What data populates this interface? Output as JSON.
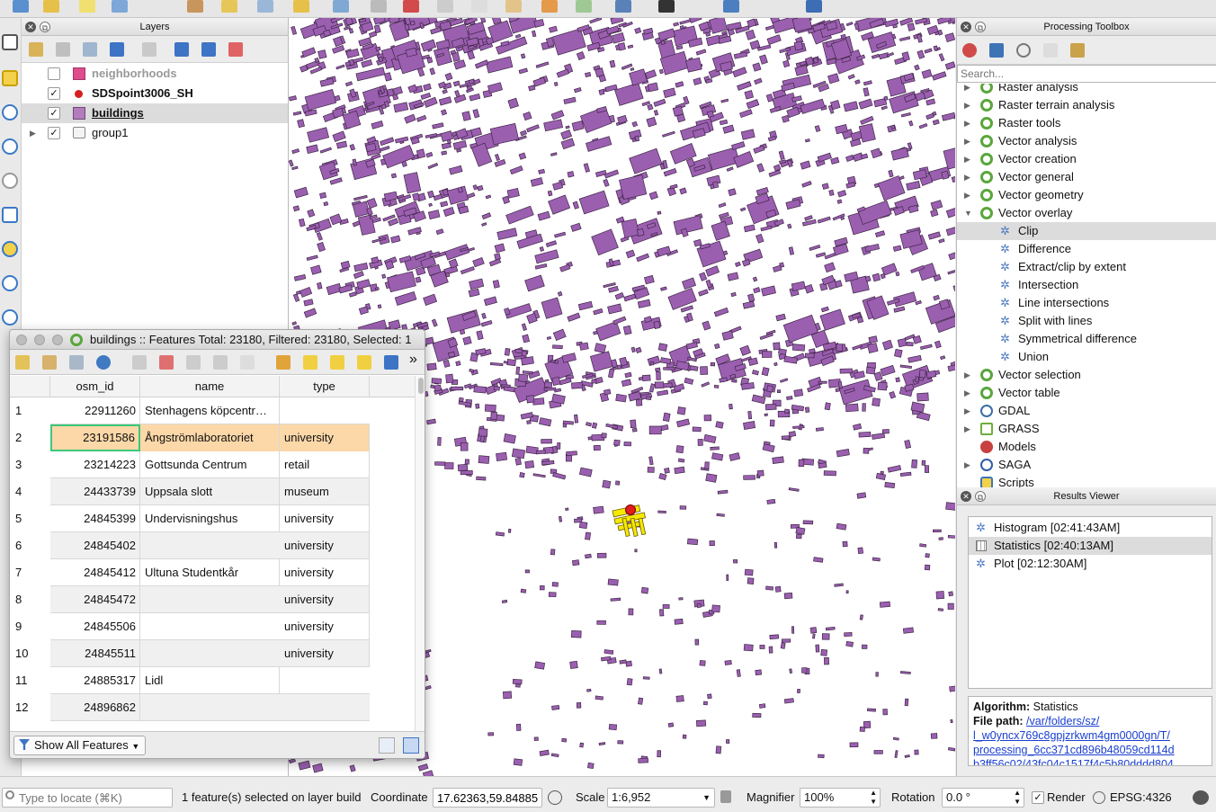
{
  "layers_panel": {
    "title": "Layers",
    "layers": [
      {
        "name": "neighborhoods",
        "checked": false,
        "symbol": "square",
        "color": "#e04b8b"
      },
      {
        "name": "SDSpoint3006_SH",
        "checked": true,
        "symbol": "dot",
        "color": "#d42020"
      },
      {
        "name": "buildings",
        "checked": true,
        "symbol": "square",
        "color": "#b27cbd"
      },
      {
        "name": "group1",
        "checked": true,
        "symbol": "group",
        "color": "#888888"
      }
    ]
  },
  "toolbox": {
    "title": "Processing Toolbox",
    "search_placeholder": "Search...",
    "items": [
      {
        "label": "Raster analysis",
        "type": "q-group"
      },
      {
        "label": "Raster terrain analysis",
        "type": "q-group"
      },
      {
        "label": "Raster tools",
        "type": "q-group"
      },
      {
        "label": "Vector analysis",
        "type": "q-group"
      },
      {
        "label": "Vector creation",
        "type": "q-group"
      },
      {
        "label": "Vector general",
        "type": "q-group"
      },
      {
        "label": "Vector geometry",
        "type": "q-group"
      },
      {
        "label": "Vector overlay",
        "type": "q-group-open"
      },
      {
        "label": "Clip",
        "type": "alg"
      },
      {
        "label": "Difference",
        "type": "alg"
      },
      {
        "label": "Extract/clip by extent",
        "type": "alg"
      },
      {
        "label": "Intersection",
        "type": "alg"
      },
      {
        "label": "Line intersections",
        "type": "alg"
      },
      {
        "label": "Split with lines",
        "type": "alg"
      },
      {
        "label": "Symmetrical difference",
        "type": "alg"
      },
      {
        "label": "Union",
        "type": "alg"
      },
      {
        "label": "Vector selection",
        "type": "q-group"
      },
      {
        "label": "Vector table",
        "type": "q-group"
      },
      {
        "label": "GDAL",
        "type": "gdal"
      },
      {
        "label": "GRASS",
        "type": "grass"
      },
      {
        "label": "Models",
        "type": "models"
      },
      {
        "label": "SAGA",
        "type": "saga"
      },
      {
        "label": "Scripts",
        "type": "scripts"
      }
    ],
    "selected": "Clip"
  },
  "results_viewer": {
    "title": "Results Viewer",
    "items": [
      {
        "label": "Histogram [02:41:43AM]"
      },
      {
        "label": "Statistics [02:40:13AM]"
      },
      {
        "label": "Plot [02:12:30AM]"
      }
    ],
    "selected": "Statistics [02:40:13AM]",
    "algorithm_label": "Algorithm:",
    "algorithm_value": "Statistics",
    "filepath_label": "File path:",
    "filepath_lines": [
      "/var/folders/sz/",
      "l_w0yncx769c8gpjzrkwm4gm0000gn/T/",
      "processing_6cc371cd896b48059cd114d",
      "b3ff56c02/43fc04c1517f4c5b80dddd804"
    ]
  },
  "attribute_table": {
    "title": "buildings :: Features Total: 23180, Filtered: 23180, Selected: 1",
    "columns": [
      "osm_id",
      "name",
      "type"
    ],
    "rows": [
      {
        "n": "1",
        "osm_id": "22911260",
        "name": "Stenhagens köpcentr…",
        "type": ""
      },
      {
        "n": "2",
        "osm_id": "23191586",
        "name": "Ångströmlaboratoriet",
        "type": "university"
      },
      {
        "n": "3",
        "osm_id": "23214223",
        "name": "Gottsunda Centrum",
        "type": "retail"
      },
      {
        "n": "4",
        "osm_id": "24433739",
        "name": "Uppsala slott",
        "type": "museum"
      },
      {
        "n": "5",
        "osm_id": "24845399",
        "name": "Undervisningshus",
        "type": "university"
      },
      {
        "n": "6",
        "osm_id": "24845402",
        "name": "",
        "type": "university"
      },
      {
        "n": "7",
        "osm_id": "24845412",
        "name": "Ultuna Studentkår",
        "type": "university"
      },
      {
        "n": "8",
        "osm_id": "24845472",
        "name": "",
        "type": "university"
      },
      {
        "n": "9",
        "osm_id": "24845506",
        "name": "",
        "type": "university"
      },
      {
        "n": "10",
        "osm_id": "24845511",
        "name": "",
        "type": "university"
      },
      {
        "n": "11",
        "osm_id": "24885317",
        "name": "Lidl",
        "type": ""
      },
      {
        "n": "12",
        "osm_id": "24896862",
        "name": "",
        "type": ""
      }
    ],
    "selected_row": "2",
    "filter_button": "Show All Features"
  },
  "status_bar": {
    "locate_placeholder": "Type to locate (⌘K)",
    "message": "1 feature(s) selected on layer build",
    "coordinate_label": "Coordinate",
    "coordinate_value": "17.62363,59.84885",
    "scale_label": "Scale",
    "scale_value": "1:6,952",
    "magnifier_label": "Magnifier",
    "magnifier_value": "100%",
    "rotation_label": "Rotation",
    "rotation_value": "0.0 °",
    "render_label": "Render",
    "render_checked": true,
    "crs": "EPSG:4326"
  },
  "colors": {
    "building_fill": "#9b5fb0",
    "building_stroke": "#3e2646",
    "selection_yellow": "#f5e900",
    "point_red": "#e01c1c",
    "row_selected": "#fcd8a8"
  }
}
